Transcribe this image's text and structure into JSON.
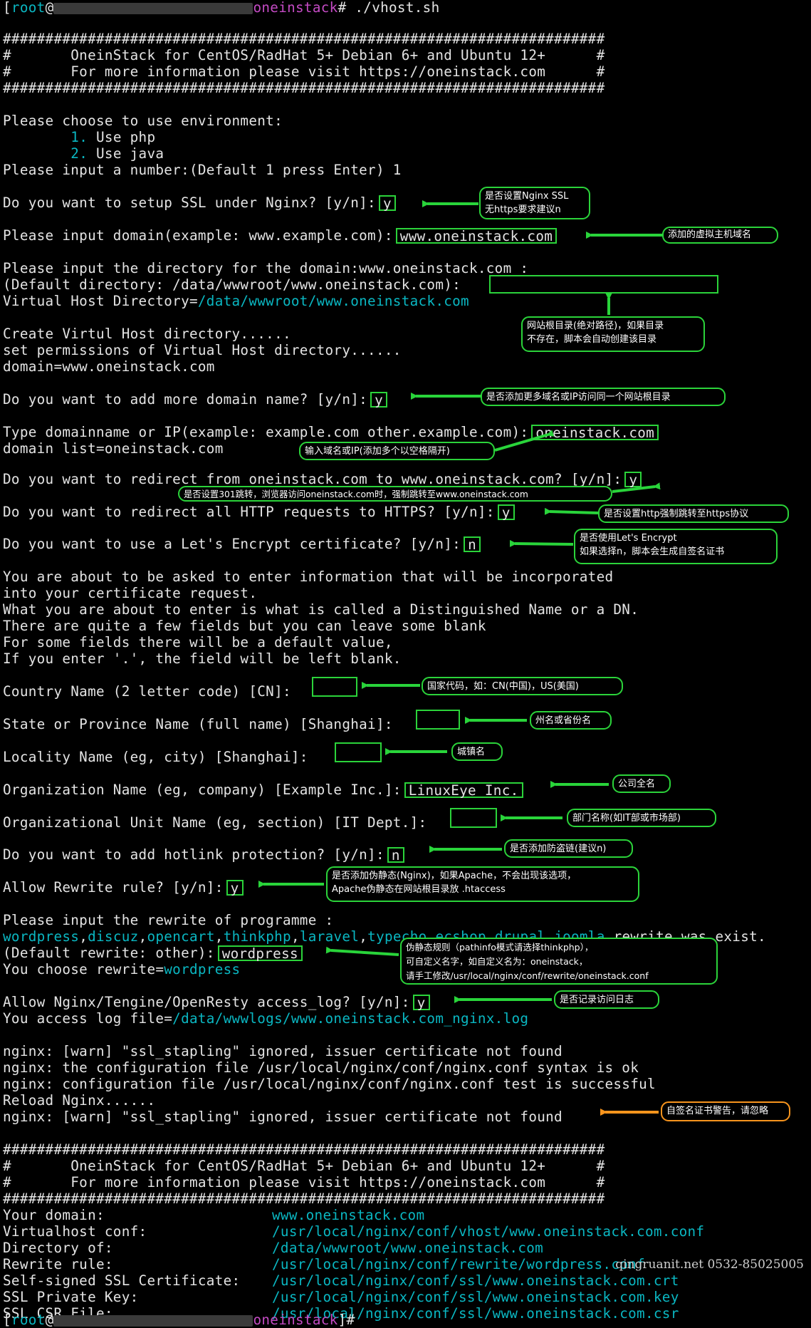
{
  "prompt": {
    "user": "root",
    "host_sep": "@",
    "dir": "oneinstack",
    "cmd": "# ./vhost.sh",
    "bracket_open": "[",
    "bracket_close": "]",
    "end": "]#"
  },
  "banner": {
    "rule": "#######################################################################",
    "l1": "#       OneinStack for CentOS/RadHat 5+ Debian 6+ and Ubuntu 12+      #",
    "l2": "#       For more information please visit https://oneinstack.com      #"
  },
  "env": {
    "q": "Please choose to use environment:",
    "o1n": "1.",
    "o1": " Use php",
    "o2n": "2.",
    "o2": " Use java",
    "input": "Please input a number:(Default 1 press Enter) 1"
  },
  "ssl": {
    "q": "Do you want to setup SSL under Nginx? [y/n]:",
    "a": "y"
  },
  "domain": {
    "q": "Please input domain(example: www.example.com):",
    "a": "www.oneinstack.com"
  },
  "dir": {
    "q1": "Please input the directory for the domain:www.oneinstack.com :",
    "q2": "(Default directory: /data/wwwroot/www.oneinstack.com):",
    "vh_label": "Virtual Host Directory=",
    "vh_value": "/data/wwwroot/www.oneinstack.com"
  },
  "create": {
    "l1": "Create Virtul Host directory......",
    "l2": "set permissions of Virtual Host directory......",
    "l3": "domain=www.oneinstack.com"
  },
  "more": {
    "q": "Do you want to add more domain name? [y/n]:",
    "a": "y"
  },
  "type": {
    "q": "Type domainname or IP(example: example.com other.example.com):",
    "a": "oneinstack.com",
    "list": "domain list=oneinstack.com"
  },
  "redirect": {
    "q": "Do you want to redirect from oneinstack.com to www.oneinstack.com? [y/n]:",
    "a": "y"
  },
  "https": {
    "q": "Do you want to redirect all HTTP requests to HTTPS? [y/n]:",
    "a": "y"
  },
  "le": {
    "q": "Do you want to use a Let's Encrypt certificate? [y/n]:",
    "a": "n"
  },
  "info": {
    "l1": "You are about to be asked to enter information that will be incorporated",
    "l2": "into your certificate request.",
    "l3": "What you are about to enter is what is called a Distinguished Name or a DN.",
    "l4": "There are quite a few fields but you can leave some blank",
    "l5": "For some fields there will be a default value,",
    "l6": "If you enter '.', the field will be left blank."
  },
  "cert": {
    "country": "Country Name (2 letter code) [CN]:",
    "state": "State or Province Name (full name) [Shanghai]:",
    "locality": "Locality Name (eg, city) [Shanghai]:",
    "org": "Organization Name (eg, company) [Example Inc.]:",
    "org_a": "LinuxEye Inc.",
    "unit": "Organizational Unit Name (eg, section) [IT Dept.]:"
  },
  "hotlink": {
    "q": "Do you want to add hotlink protection? [y/n]:",
    "a": "n"
  },
  "rewrite": {
    "q": "Allow Rewrite rule? [y/n]:",
    "a": "y",
    "p": "Please input the rewrite of programme :",
    "progs": [
      "wordpress",
      "discuz",
      "opencart",
      "thinkphp",
      "laravel",
      "typecho",
      "ecshop",
      "drupal",
      "joomla"
    ],
    "exist": " rewrite was exist.",
    "def": "(Default rewrite: other):",
    "def_a": "wordpress",
    "choose": "You choose rewrite=",
    "choose_v": "wordpress"
  },
  "log": {
    "q": "Allow Nginx/Tengine/OpenResty access_log? [y/n]:",
    "a": "y",
    "file_label": "You access log file=",
    "file_v": "/data/wwwlogs/www.oneinstack.com_nginx.log"
  },
  "nginx": {
    "l1": "nginx: [warn] \"ssl_stapling\" ignored, issuer certificate not found",
    "l2": "nginx: the configuration file /usr/local/nginx/conf/nginx.conf syntax is ok",
    "l3": "nginx: configuration file /usr/local/nginx/conf/nginx.conf test is successful",
    "l4": "Reload Nginx......",
    "l5": "nginx: [warn] \"ssl_stapling\" ignored, issuer certificate not found"
  },
  "summary": [
    {
      "k": "Your domain:",
      "v": "www.oneinstack.com"
    },
    {
      "k": "Virtualhost conf:",
      "v": "/usr/local/nginx/conf/vhost/www.oneinstack.com.conf"
    },
    {
      "k": "Directory of:",
      "v": "/data/wwwroot/www.oneinstack.com"
    },
    {
      "k": "Rewrite rule:",
      "v": "/usr/local/nginx/conf/rewrite/wordpress.conf"
    },
    {
      "k": "Self-signed SSL Certificate:",
      "v": "/usr/local/nginx/conf/ssl/www.oneinstack.com.crt"
    },
    {
      "k": "SSL Private Key:",
      "v": "/usr/local/nginx/conf/ssl/www.oneinstack.com.key"
    },
    {
      "k": "SSL CSR File:",
      "v": "/usr/local/nginx/conf/ssl/www.oneinstack.com.csr"
    }
  ],
  "notes": {
    "ssl1": "是否设置Nginx SSL",
    "ssl2": "无https要求建议n",
    "domain": "添加的虚拟主机域名",
    "dir1": "网站根目录(绝对路径)，如果目录",
    "dir2": "不存在，脚本会自动创建该目录",
    "more": "是否添加更多域名或IP访问同一个网站根目录",
    "type": "输入域名或IP(添加多个以空格隔开)",
    "redirect": "是否设置301跳转，浏览器访问oneinstack.com时，强制跳转至www.oneinstack.com",
    "https": "是否设置http强制跳转至https协议",
    "le1": "是否使用Let's Encrypt",
    "le2": "如果选择n，脚本会生成自签名证书",
    "country": "国家代码，如：CN(中国)，US(美国)",
    "state": "州名或省份名",
    "city": "城镇名",
    "org": "公司全名",
    "unit": "部门名称(如IT部或市场部)",
    "hotlink": "是否添加防盗链(建议n)",
    "rewrite1": "是否添加伪静态(Nginx)，如果Apache，不会出现该选项，",
    "rewrite2": "Apache伪静态在网站根目录放 .htaccess",
    "prog1": "伪静态规则（pathinfo模式请选择thinkphp），",
    "prog2": "可自定义名字，如自定义名为：oneinstack，",
    "prog3": "请手工修改/usr/local/nginx/conf/rewrite/oneinstack.conf",
    "log": "是否记录访问日志",
    "warn": "自签名证书警告，请忽略"
  },
  "watermark": "qingruanit.net 0532-85025005",
  "colors": {
    "bg": "#000000",
    "text": "#e4e4e4",
    "cyan": "#0ab7c2",
    "magenta": "#c44bc4",
    "green_box": "#2bd33a",
    "arrow_green": "#29d43a",
    "arrow_orange": "#f7941d"
  }
}
